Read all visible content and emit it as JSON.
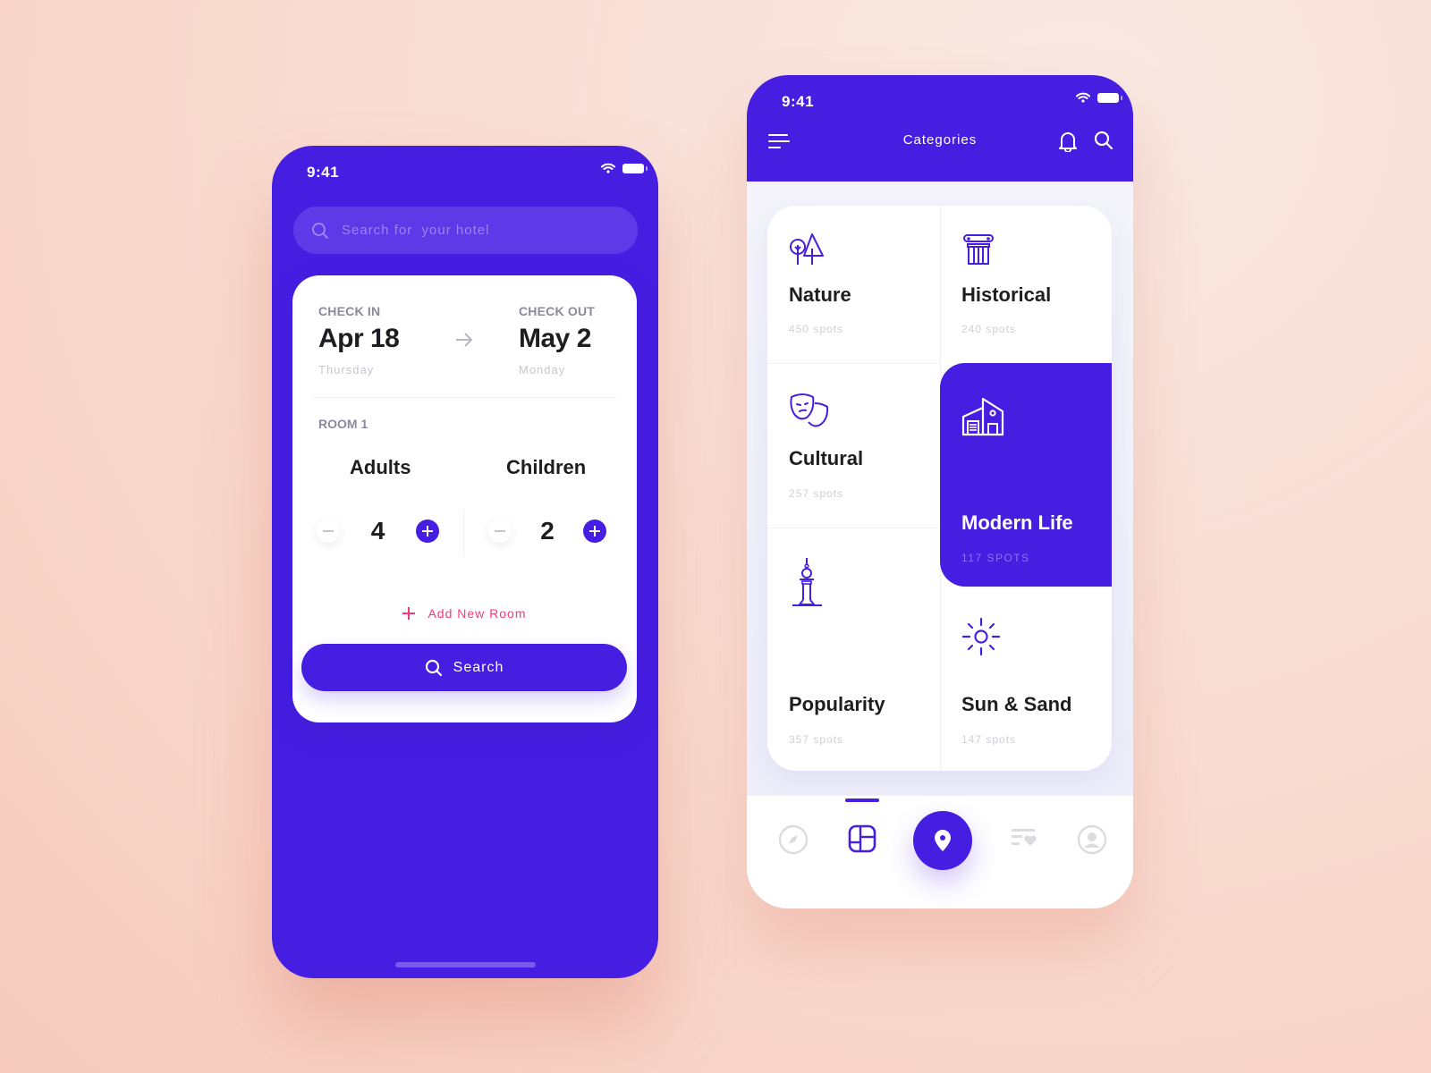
{
  "colors": {
    "brand": "#461ee2",
    "accent_pink": "#ef3b79",
    "text_dark": "#1e1e22",
    "text_muted": "#8b8a9b",
    "text_light": "#c7c6cf"
  },
  "booking_screen": {
    "status_bar": {
      "time": "9:41",
      "icons": [
        "wifi-icon",
        "battery-icon"
      ]
    },
    "search": {
      "placeholder": "Search for  your hotel",
      "value": "",
      "icon": "search-icon"
    },
    "check_in": {
      "label": "CHECK IN",
      "date": "Apr 18",
      "day": "Thursday"
    },
    "check_out": {
      "label": "CHECK OUT",
      "date": "May 2",
      "day": "Monday"
    },
    "arrow_icon": "arrow-right-icon",
    "room": {
      "label": "ROOM 1",
      "adults": {
        "label": "Adults",
        "value": "4"
      },
      "children": {
        "label": "Children",
        "value": "2"
      }
    },
    "add_room_label": "Add New Room",
    "search_button_label": "Search"
  },
  "categories_screen": {
    "status_bar": {
      "time": "9:41",
      "icons": [
        "wifi-icon",
        "battery-icon"
      ]
    },
    "header": {
      "title": "Categories",
      "left_icon": "menu-icon",
      "right_icons": [
        "bell-icon",
        "search-icon"
      ]
    },
    "categories": [
      {
        "name": "Nature",
        "count": "450 spots",
        "icon": "trees-icon",
        "active": false
      },
      {
        "name": "Historical",
        "count": "240 spots",
        "icon": "column-icon",
        "active": false
      },
      {
        "name": "Cultural",
        "count": "257 spots",
        "icon": "theater-masks-icon",
        "active": false
      },
      {
        "name": "Modern Life",
        "count": "117 SPOTS",
        "icon": "modern-building-icon",
        "active": true
      },
      {
        "name": "Popularity",
        "count": "357 spots",
        "icon": "tower-icon",
        "active": false
      },
      {
        "name": "Sun & Sand",
        "count": "147 spots",
        "icon": "sun-icon",
        "active": false
      }
    ],
    "tab_bar": {
      "tabs": [
        "compass-icon",
        "grid-icon",
        "location-pin-icon",
        "favorites-list-icon",
        "profile-icon"
      ],
      "active": "grid-icon"
    }
  }
}
